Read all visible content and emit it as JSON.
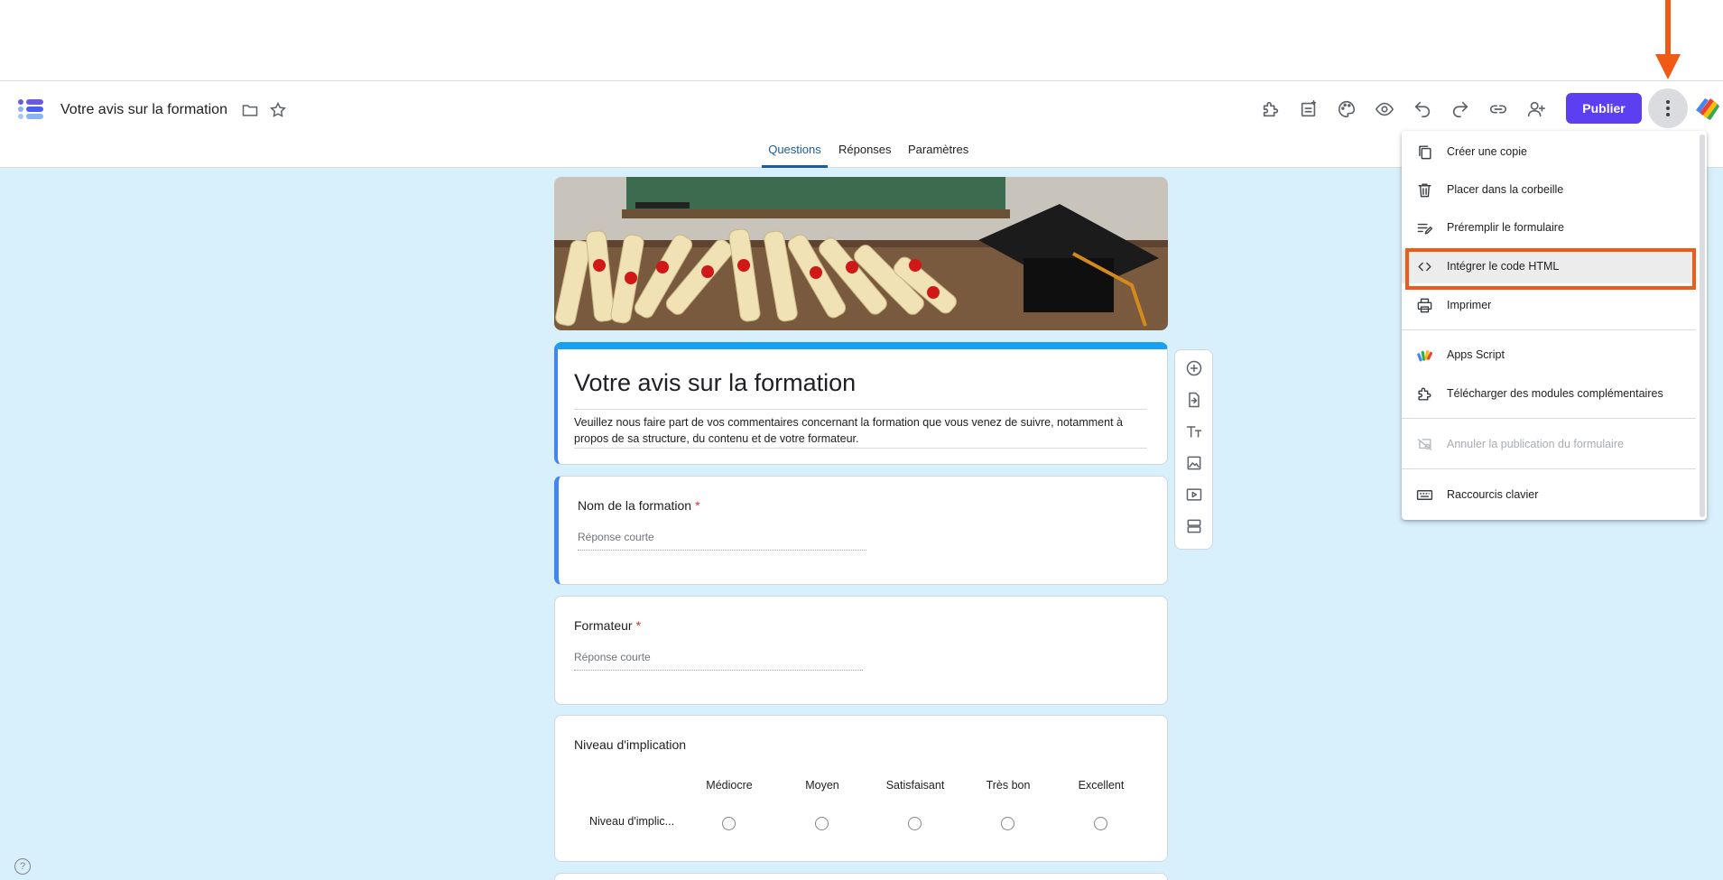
{
  "header": {
    "doc_title": "Votre avis sur la formation",
    "publish_label": "Publier",
    "icons": [
      "addon-puzzle-icon",
      "sheets-ai-icon",
      "palette-icon",
      "preview-eye-icon",
      "undo-icon",
      "redo-icon",
      "link-icon",
      "add-collaborator-icon"
    ]
  },
  "tabs": [
    {
      "label": "Questions",
      "active": true
    },
    {
      "label": "Réponses",
      "active": false
    },
    {
      "label": "Paramètres",
      "active": false
    }
  ],
  "form": {
    "title": "Votre avis sur la formation",
    "description": "Veuillez nous faire part de vos commentaires concernant la formation que vous venez de suivre, notamment à propos de sa structure, du contenu et de votre formateur.",
    "questions": [
      {
        "title": "Nom de la formation",
        "required_mark": "*",
        "placeholder": "Réponse courte"
      },
      {
        "title": "Formateur",
        "required_mark": "*",
        "placeholder": "Réponse courte"
      }
    ],
    "grid_question": {
      "title": "Niveau d'implication",
      "columns": [
        "Médiocre",
        "Moyen",
        "Satisfaisant",
        "Très bon",
        "Excellent"
      ],
      "row_label": "Niveau d'implic..."
    }
  },
  "menu": {
    "items": [
      {
        "label": "Créer une copie",
        "icon": "copy-icon",
        "disabled": false
      },
      {
        "label": "Placer dans la corbeille",
        "icon": "trash-icon",
        "disabled": false
      },
      {
        "label": "Préremplir le formulaire",
        "icon": "prefill-edit-icon",
        "disabled": false
      },
      {
        "label": "Intégrer le code HTML",
        "icon": "code-embed-icon",
        "disabled": false
      },
      {
        "label": "Imprimer",
        "icon": "print-icon",
        "disabled": false
      },
      {
        "label": "Apps Script",
        "icon": "apps-script-icon",
        "disabled": false
      },
      {
        "label": "Télécharger des modules complémentaires",
        "icon": "addon-puzzle-icon",
        "disabled": false
      },
      {
        "label": "Annuler la publication du formulaire",
        "icon": "unpublish-icon",
        "disabled": true
      },
      {
        "label": "Raccourcis clavier",
        "icon": "keyboard-icon",
        "disabled": false
      }
    ]
  },
  "help": {
    "glyph": "?"
  },
  "colors": {
    "accent": "#5b3ff0",
    "tab_active": "#1a5da0",
    "canvas_bg": "#d8effc",
    "title_card_top": "#1aa0f0",
    "highlight_border": "#f05a14",
    "required": "#d93025"
  }
}
